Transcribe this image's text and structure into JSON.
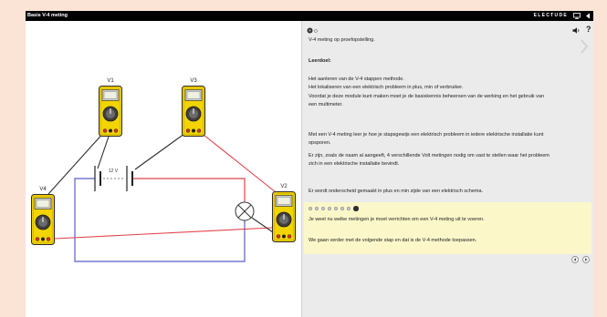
{
  "window": {
    "title": "Basis V-4 meting",
    "brand": "ELECTUDE",
    "icons": {
      "fullscreen": "monitor-icon",
      "collapse": "caret-left-icon"
    }
  },
  "colors": {
    "page_background": "#fbe3d6",
    "title_bar": "#000000",
    "diagram_background": "#ffffff",
    "content_background": "#ebebeb",
    "highlight_background": "#fbf7c9",
    "meter_body": "#f2d400",
    "wire_red": "#e0444c",
    "wire_black": "#2e2e2e",
    "wire_blue": "#5b5fc2"
  },
  "diagram": {
    "meters": [
      {
        "label": "V1"
      },
      {
        "label": "V2"
      },
      {
        "label": "V3"
      },
      {
        "label": "V4"
      }
    ],
    "battery_label": "12 V"
  },
  "content": {
    "toolbar": {
      "left_icons": [
        "record-icon",
        "small-circle-icon"
      ],
      "right_icons": [
        "speaker-icon",
        "help-icon"
      ],
      "help_label": "?"
    },
    "next_page_icon": "chevron-right-icon",
    "subtitle": "V-4 meting op proefopstelling.",
    "goal_heading": "Leerdoel:",
    "paragraphs": [
      {
        "lines": [
          "Het aanleren van de V-4 stappen methode.",
          "Het lokaliseren van een elektrisch probleem in plus, min of verbruiker."
        ]
      },
      {
        "lines": [
          "Voordat je deze module kunt maken moet je de basiskennis beheersen van de werking en het gebruik van",
          "een multimeter."
        ]
      },
      {
        "lines": [
          "Met een V-4 meting leer je hoe je stapsgewijs een elektrisch probleem in iedere elektrische installatie kunt",
          "opsporen."
        ]
      },
      {
        "lines": [
          "Er zijn, zoals de naam al aangeeft, 4 verschillende Volt metingen nodig om vast te stellen waar het probleem",
          "zich in een elektrische installatie bevindt."
        ]
      },
      {
        "lines": [
          "Er wordt onderscheid gemaakt in plus en min zijde van een elektrisch schema."
        ]
      }
    ],
    "highlight": {
      "progress": {
        "total_steps": 8,
        "current_step": 8
      },
      "lines": [
        "Je weet nu welke metingen je moet verrichten om een V-4 meting uit te voeren.",
        "We gaan verder met de volgende stap en dat is de V-4 methode toepassen."
      ]
    },
    "footer_icons": [
      "previous-icon",
      "next-icon"
    ]
  }
}
